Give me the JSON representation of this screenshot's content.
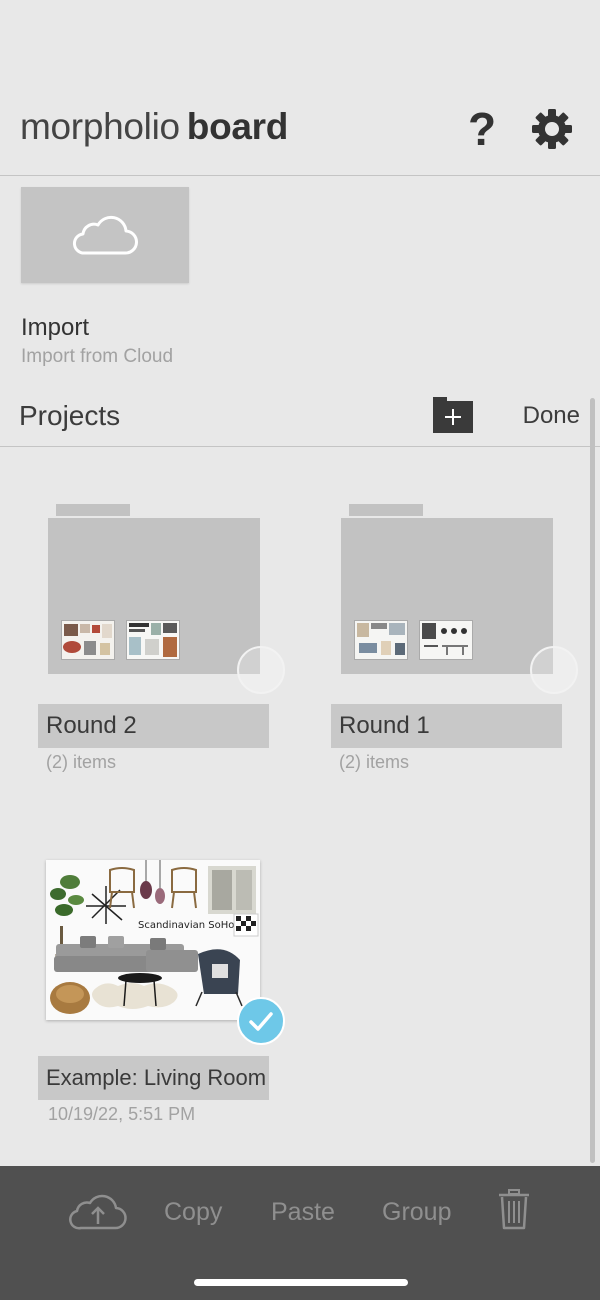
{
  "header": {
    "brand_light": "morpholio",
    "brand_bold": "board",
    "help_glyph": "?"
  },
  "import": {
    "title": "Import",
    "subtitle": "Import from Cloud",
    "icon": "cloud-icon"
  },
  "projects": {
    "title": "Projects",
    "done_label": "Done",
    "new_folder_glyph": "+",
    "items": [
      {
        "kind": "folder",
        "name": "Round 2",
        "meta": "(2) items",
        "selected": false
      },
      {
        "kind": "folder",
        "name": "Round 1",
        "meta": "(2) items",
        "selected": false
      },
      {
        "kind": "board",
        "name": "Example: Living Room",
        "meta": "10/19/22, 5:51 PM",
        "selected": true,
        "board_caption": "Scandinavian SoHo"
      }
    ]
  },
  "toolbar": {
    "upload_icon": "cloud-upload-icon",
    "copy_label": "Copy",
    "paste_label": "Paste",
    "group_label": "Group",
    "trash_icon": "trash-icon"
  },
  "colors": {
    "background": "#e8e8e8",
    "tile": "#c4c4c4",
    "toolbar": "#505050",
    "check_accent": "#6ec8e8"
  }
}
